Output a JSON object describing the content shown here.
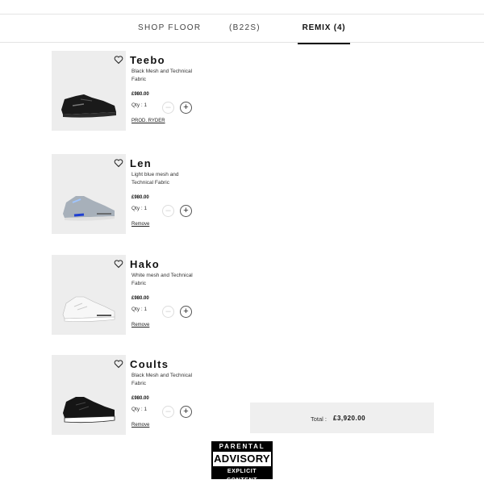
{
  "nav": {
    "tabs": [
      {
        "label": "SHOP FLOOR"
      },
      {
        "label": "(B22S)"
      },
      {
        "label": "REMIX (4)",
        "active": true
      }
    ]
  },
  "items": [
    {
      "name": "Teebo",
      "desc": "Black Mesh and Technical Fabric",
      "price": "£980.00",
      "qty": "Qty : 1",
      "link": "PROD. RYDER",
      "minus": "–",
      "plus": "+",
      "fav_icon": "heart-icon",
      "shoe_color": "#1a1a1a"
    },
    {
      "name": "Len",
      "desc": "Light blue mesh and Technical Fabric",
      "price": "£980.00",
      "qty": "Qty : 1",
      "link": "Remove",
      "minus": "–",
      "plus": "+",
      "fav_icon": "heart-icon",
      "shoe_color": "#9aa3ad"
    },
    {
      "name": "Hako",
      "desc": "White mesh and Technical Fabric",
      "price": "£980.00",
      "qty": "Qty : 1",
      "link": "Remove",
      "minus": "–",
      "plus": "+",
      "fav_icon": "heart-icon",
      "shoe_color": "#f4f4f4"
    },
    {
      "name": "Coults",
      "desc": "Black Mesh and Technical Fabric",
      "price": "£980.00",
      "qty": "Qty : 1",
      "link": "Remove",
      "minus": "–",
      "plus": "+",
      "fav_icon": "heart-icon",
      "shoe_color": "#151515"
    }
  ],
  "summary": {
    "total_label": "Total :",
    "total_value": "£3,920.00"
  },
  "advisory": {
    "top": "PARENTAL",
    "middle": "ADVISORY",
    "bottom": "EXPLICIT CONTENT"
  }
}
